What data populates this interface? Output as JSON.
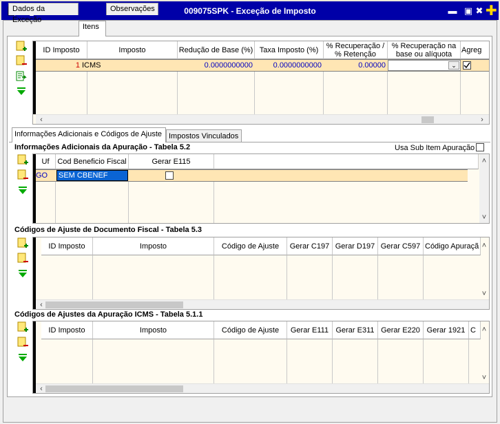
{
  "window": {
    "title": "009075SPK - Exceção de Imposto"
  },
  "tabs": [
    {
      "label": "Dados da Exceção"
    },
    {
      "label": "Itens"
    },
    {
      "label": "Observações"
    }
  ],
  "items_grid": {
    "headers": [
      "ID Imposto",
      "Imposto",
      "Redução de Base (%)",
      "Taxa Imposto (%)",
      "% Recuperação / % Retenção",
      "% Recuperação na base ou alíquota",
      "Agreg"
    ],
    "row": {
      "id": "1",
      "imposto": "ICMS",
      "reducao": "0.0000000000",
      "taxa": "0.0000000000",
      "recuperacao": "0.00000",
      "base_aliquota": ""
    }
  },
  "subtabs": [
    {
      "label": "Informações Adicionais e Códigos de Ajuste"
    },
    {
      "label": "Impostos Vinculados"
    }
  ],
  "info_section": {
    "title": "Informações Adicionais da Apuração - Tabela 5.2",
    "sub_item_label": "Usa Sub Item Apuração",
    "headers": [
      "Uf",
      "Cod Beneficio Fiscal",
      "Gerar E115"
    ],
    "row": {
      "uf": "GO",
      "cod": "SEM CBENEF"
    }
  },
  "doc_section": {
    "title": "Códigos de Ajuste de Documento Fiscal - Tabela 5.3",
    "headers": [
      "ID Imposto",
      "Imposto",
      "Código de Ajuste",
      "Gerar C197",
      "Gerar D197",
      "Gerar C597",
      "Código Apuraçã"
    ]
  },
  "icms_section": {
    "title": "Códigos de Ajustes da Apuração ICMS - Tabela 5.1.1",
    "headers": [
      "ID Imposto",
      "Imposto",
      "Código de Ajuste",
      "Gerar E111",
      "Gerar E311",
      "Gerar E220",
      "Gerar 1921",
      "C"
    ]
  }
}
